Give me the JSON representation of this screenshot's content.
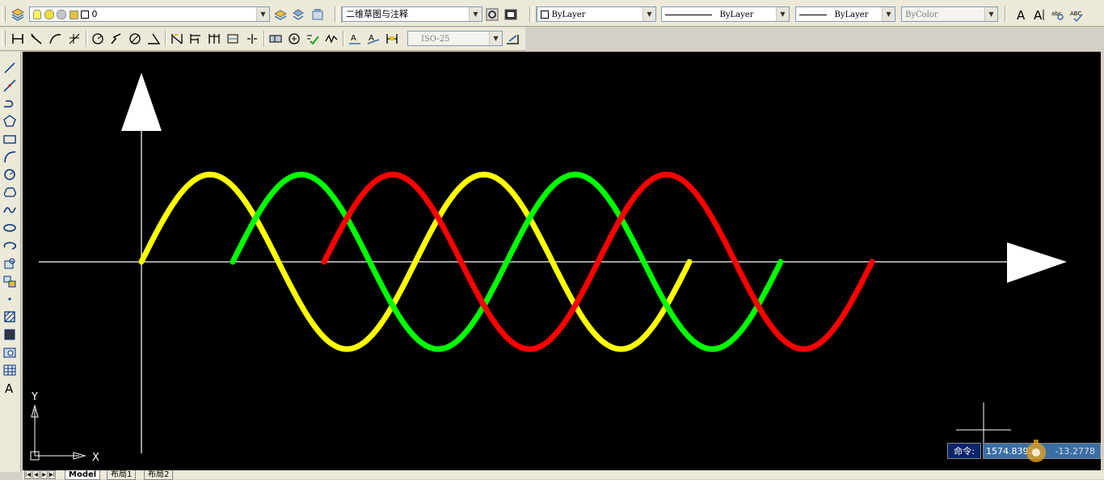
{
  "toolbar_top": {
    "layer_value": "0",
    "text_style": "二维草图与注释",
    "color": "ByLayer",
    "linetype": "ByLayer",
    "lineweight": "ByLayer",
    "plotstyle": "ByColor"
  },
  "toolbar_dim": {
    "dim_style": "ISO-25"
  },
  "drawing": {
    "ucs_y_label": "Y",
    "ucs_x_label": "X",
    "curves": [
      {
        "color": "#ffff00",
        "phase_deg": 0
      },
      {
        "color": "#00ff00",
        "phase_deg": 120
      },
      {
        "color": "#ff0000",
        "phase_deg": 240
      }
    ]
  },
  "tabs": {
    "model": "Model",
    "layout1": "布局1",
    "layout2": "布局2"
  },
  "status": {
    "command_label": "命令:",
    "coord_x": "1574.8392",
    "coord_y": "-13.2778"
  },
  "colors": {
    "canvas": "#000000",
    "axis": "#ffffff",
    "toolbar": "#ece9d8",
    "command_bg": "#0a246a",
    "coord_bg": "#3a6ea5"
  }
}
